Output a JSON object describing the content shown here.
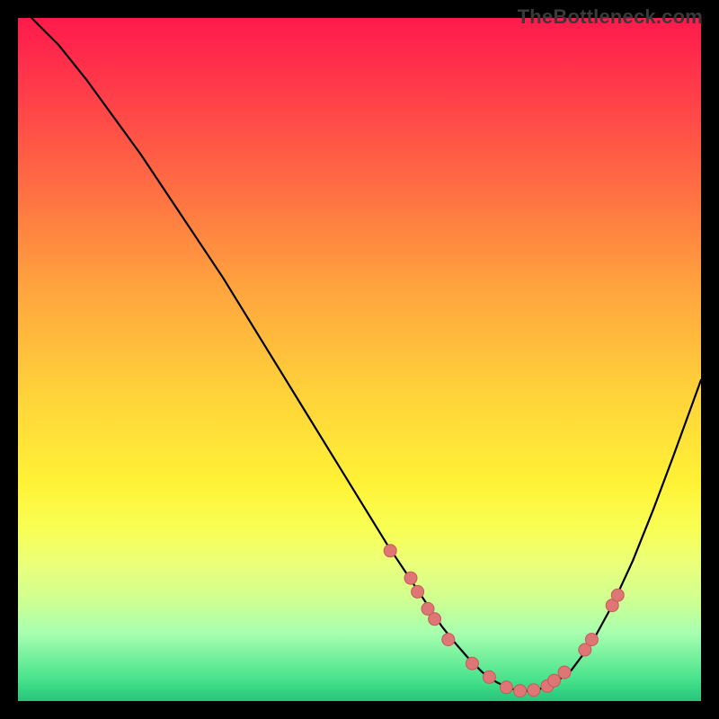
{
  "watermark": "TheBottleneck.com",
  "colors": {
    "curve": "#000000",
    "dot_fill": "#de7675",
    "dot_stroke": "#c55a59"
  },
  "chart_data": {
    "type": "line",
    "title": "",
    "xlabel": "",
    "ylabel": "",
    "xlim": [
      0,
      100
    ],
    "ylim": [
      0,
      100
    ],
    "series": [
      {
        "name": "curve",
        "x": [
          2,
          6,
          10,
          14,
          18,
          22,
          26,
          30,
          34,
          38,
          42,
          46,
          50,
          54,
          58,
          62,
          64,
          66,
          68,
          70,
          72,
          75,
          78,
          81,
          84,
          87,
          90,
          93,
          96,
          100
        ],
        "y": [
          100,
          96,
          91,
          85.5,
          80,
          74,
          68,
          62,
          55.5,
          49,
          42.5,
          36,
          29.5,
          23,
          17,
          11,
          8.5,
          6.2,
          4.2,
          2.8,
          1.8,
          1.4,
          2.2,
          4.5,
          8.5,
          14,
          20.5,
          28,
          36,
          47
        ]
      }
    ],
    "dots": [
      {
        "x": 54.5,
        "y": 22.0
      },
      {
        "x": 57.5,
        "y": 18.0
      },
      {
        "x": 58.5,
        "y": 16.0
      },
      {
        "x": 60.0,
        "y": 13.5
      },
      {
        "x": 61.0,
        "y": 12.0
      },
      {
        "x": 63.0,
        "y": 9.0
      },
      {
        "x": 66.5,
        "y": 5.5
      },
      {
        "x": 69.0,
        "y": 3.5
      },
      {
        "x": 71.5,
        "y": 2.0
      },
      {
        "x": 73.5,
        "y": 1.5
      },
      {
        "x": 75.5,
        "y": 1.6
      },
      {
        "x": 77.5,
        "y": 2.2
      },
      {
        "x": 78.5,
        "y": 3.0
      },
      {
        "x": 80.0,
        "y": 4.2
      },
      {
        "x": 83.0,
        "y": 7.5
      },
      {
        "x": 84.0,
        "y": 9.0
      },
      {
        "x": 87.0,
        "y": 14.0
      },
      {
        "x": 87.8,
        "y": 15.5
      }
    ],
    "dot_radius": 7
  }
}
